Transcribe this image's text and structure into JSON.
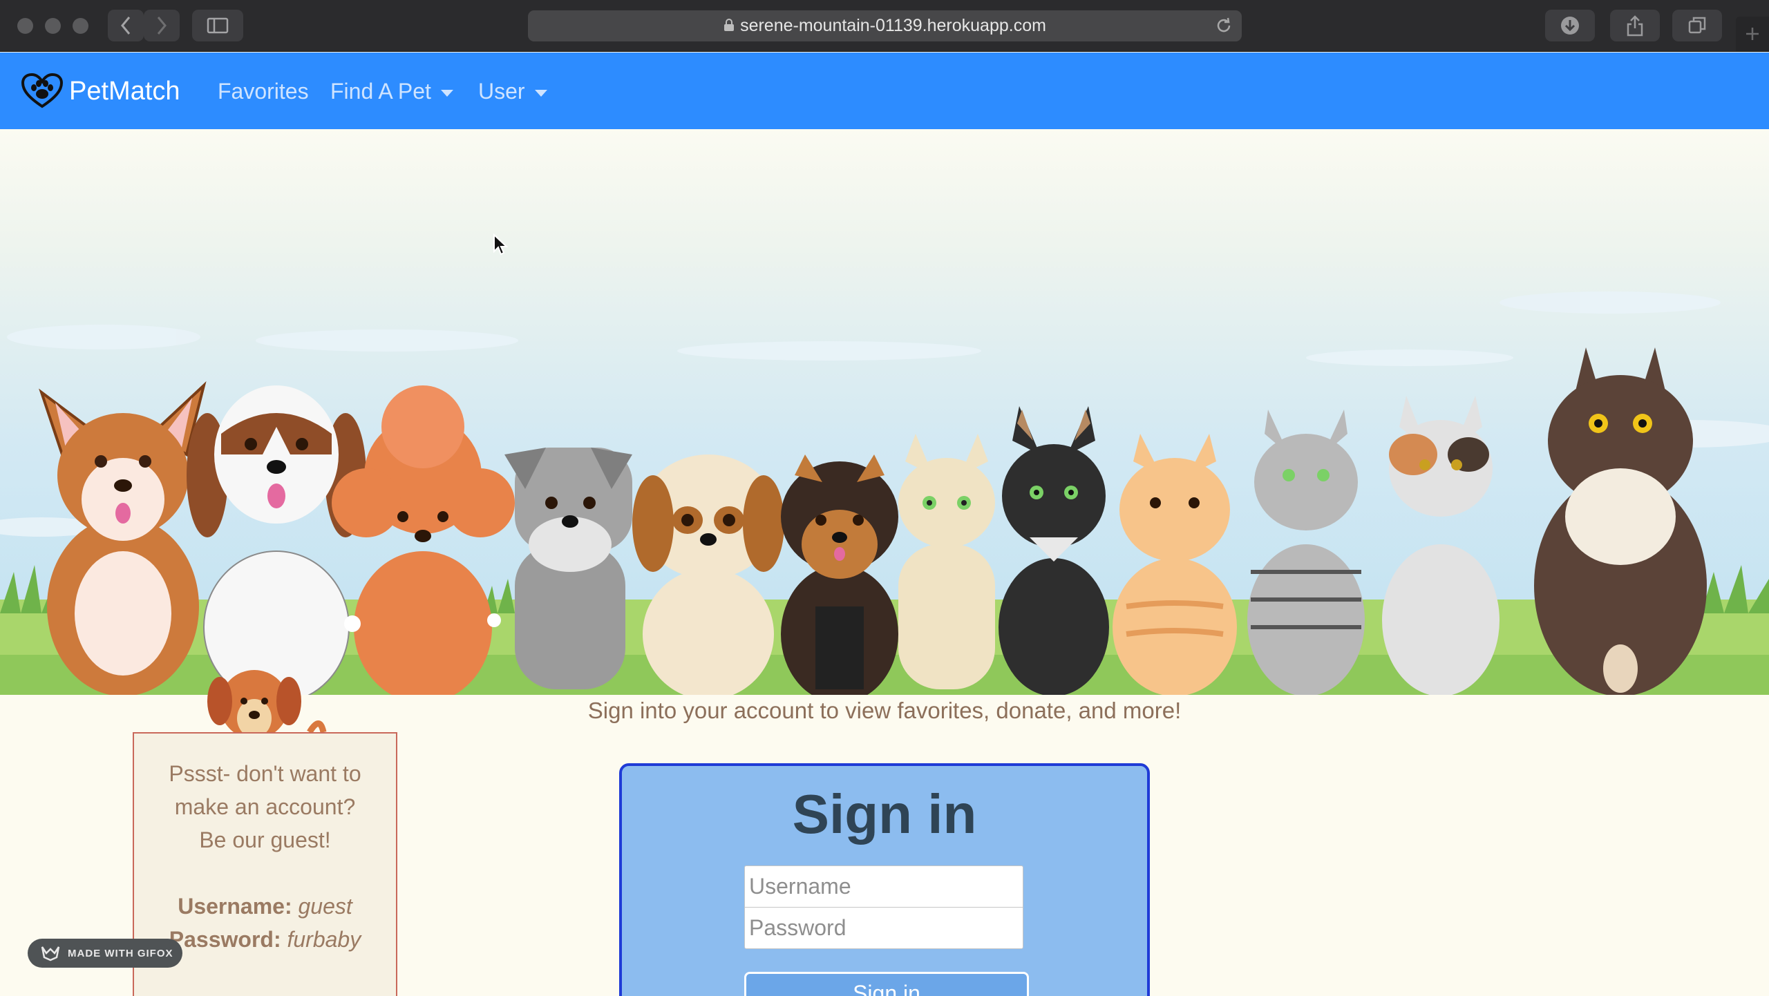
{
  "browser": {
    "url": "serene-mountain-01139.herokuapp.com"
  },
  "navbar": {
    "brand": "PetMatch",
    "links": [
      "Favorites",
      "Find A Pet",
      "User"
    ]
  },
  "hero": {
    "tagline": "Sign into your account to view favorites, donate, and more!"
  },
  "guest_note": {
    "line1": "Pssst- don't want to",
    "line2": "make an account?",
    "line3": "Be our guest!",
    "username_label": "Username:",
    "username_value": "guest",
    "password_label": "Password:",
    "password_value": "furbaby"
  },
  "signin": {
    "title": "Sign in",
    "username_placeholder": "Username",
    "password_placeholder": "Password",
    "button_label": "Sign in"
  },
  "watermark": {
    "text": "MADE WITH GIFOX"
  },
  "colors": {
    "navbar": "#2d8cff",
    "card": "#8cbcef",
    "card_border": "#1f3bd6"
  }
}
